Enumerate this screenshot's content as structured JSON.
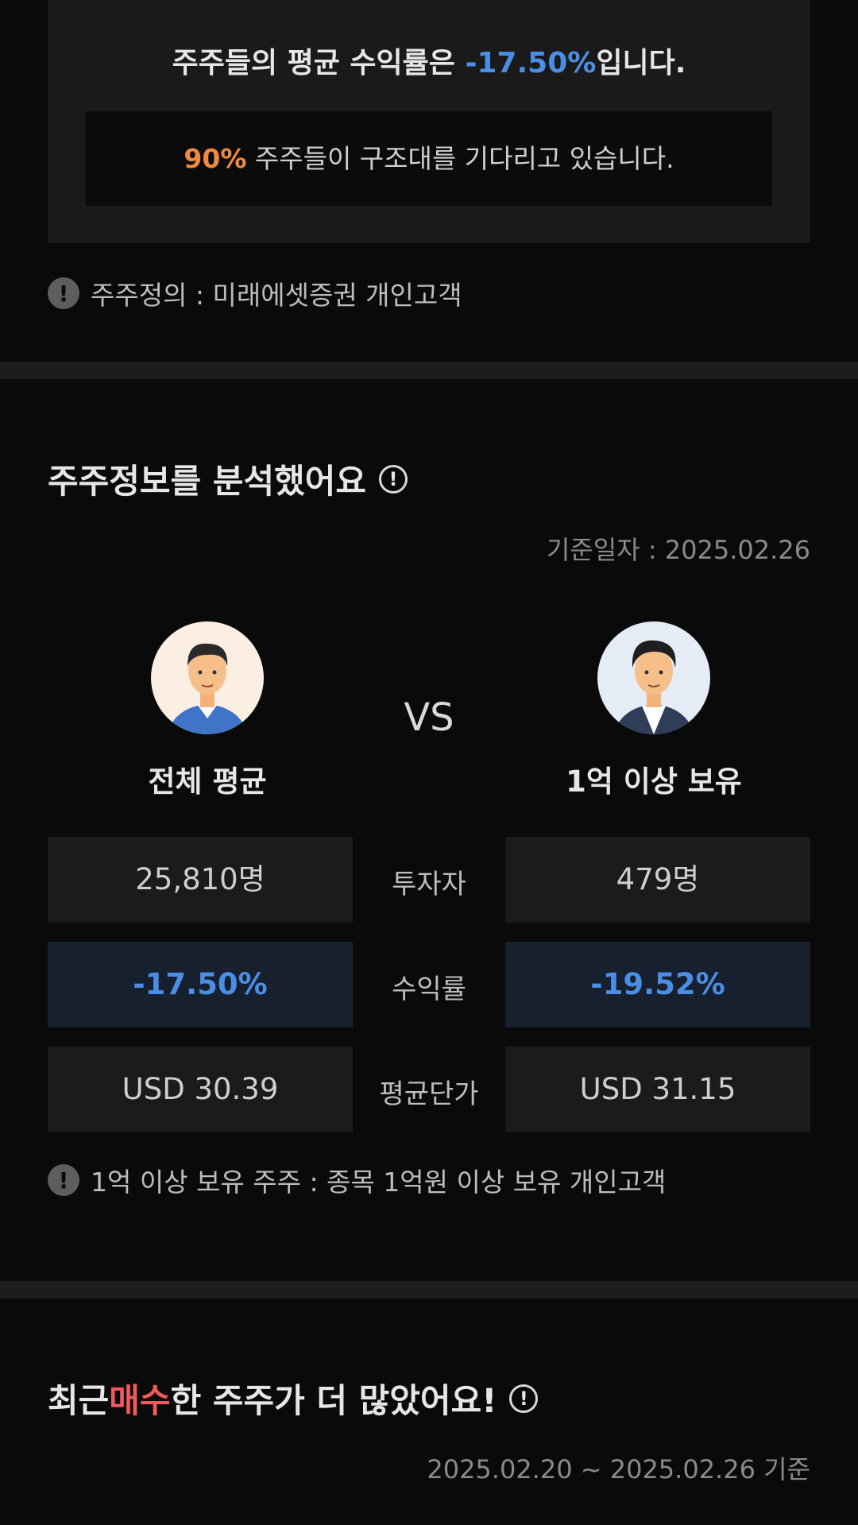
{
  "summary": {
    "headline_prefix": "주주들의 평균 수익률은 ",
    "headline_value": "-17.50%",
    "headline_suffix": "입니다.",
    "waiting_percent": "90%",
    "waiting_text": " 주주들이 구조대를 기다리고 있습니다.",
    "note": "주주정의 : 미래에셋증권 개인고객"
  },
  "analysis": {
    "title": "주주정보를 분석했어요",
    "date": "기준일자 : 2025.02.26",
    "vs": "VS",
    "left_group": "전체 평균",
    "right_group": "1억 이상 보유",
    "rows": [
      {
        "label": "투자자",
        "left": "25,810명",
        "right": "479명"
      },
      {
        "label": "수익률",
        "left": "-17.50%",
        "right": "-19.52%"
      },
      {
        "label": "평균단가",
        "left": "USD 30.39",
        "right": "USD 31.15"
      }
    ],
    "note": "1억 이상 보유 주주 : 종목 1억원 이상 보유 개인고객"
  },
  "recent": {
    "title_prefix": "최근 ",
    "title_highlight": "매수",
    "title_suffix": "한 주주가 더 많았어요!",
    "date_range": "2025.02.20 ~ 2025.02.26 기준"
  },
  "colors": {
    "accent_blue": "#4a8ee6",
    "accent_orange": "#f08a3c",
    "accent_red": "#ef5a5a"
  },
  "icons": [
    "exclamation-icon",
    "info-icon",
    "avatar-average-investor",
    "avatar-large-holder"
  ]
}
